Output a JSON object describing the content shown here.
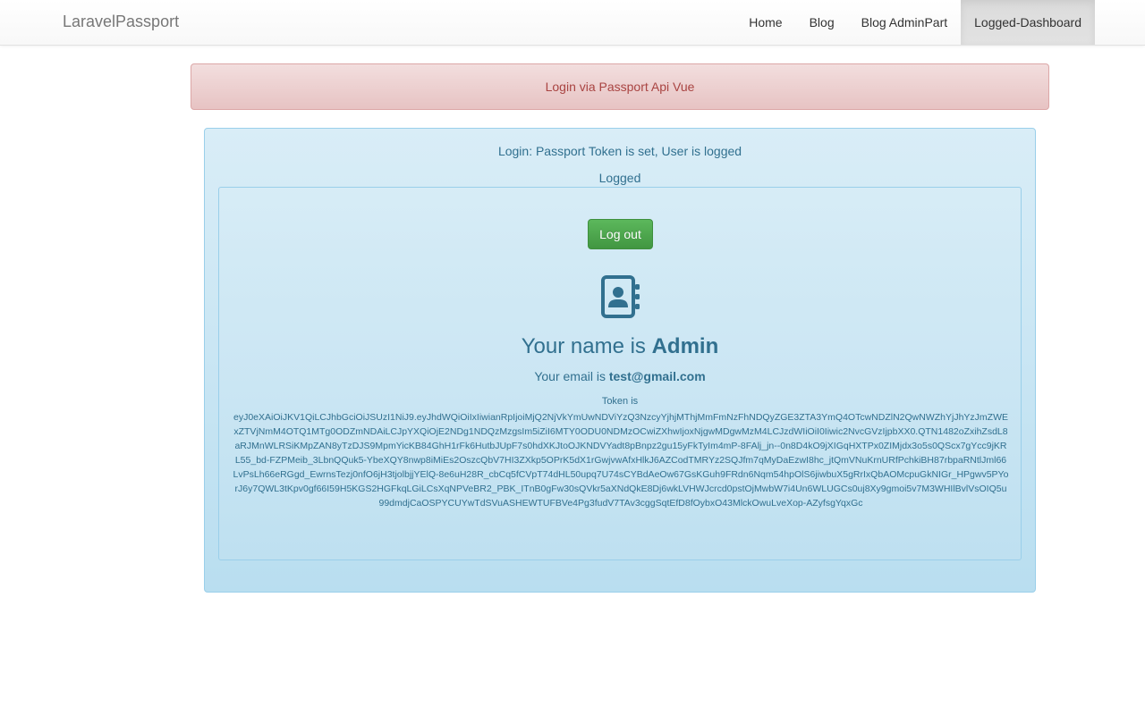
{
  "navbar": {
    "brand": "LaravelPassport",
    "items": [
      {
        "label": "Home"
      },
      {
        "label": "Blog"
      },
      {
        "label": "Blog AdminPart"
      },
      {
        "label": "Logged-Dashboard",
        "active": true
      }
    ]
  },
  "alert": {
    "text": "Login via Passport Api Vue"
  },
  "panel": {
    "status": "Login: Passport Token is set, User is logged",
    "state": "Logged",
    "logout_label": "Log out",
    "icon": "address-book-icon",
    "name_prefix": "Your name is ",
    "name": "Admin",
    "email_prefix": "Your email is ",
    "email": "test@gmail.com",
    "token_label": "Token is",
    "token": "eyJ0eXAiOiJKV1QiLCJhbGciOiJSUzI1NiJ9.eyJhdWQiOiIxIiwianRpIjoiMjQ2NjVkYmUwNDViYzQ3NzcyYjhjMThjMmFmNzFhNDQyZGE3ZTA3YmQ4OTcwNDZlN2QwNWZhYjJhYzJmZWExZTVjNmM4OTQ1MTg0ODZmNDAiLCJpYXQiOjE2NDg1NDQzMzgsIm5iZiI6MTY0ODU0NDMzOCwiZXhwIjoxNjgwMDgwMzM4LCJzdWIiOiI0Iiwic2NvcGVzIjpbXX0.QTN1482oZxihZsdL8aRJMnWLRSiKMpZAN8yTzDJS9MpmYicKB84GhH1rFk6HutbJUpF7s0hdXKJtoOJKNDVYadt8pBnpz2gu15yFkTyIm4mP-8FAlj_jn--0n8D4kO9jXIGqHXTPx0ZIMjdx3o5s0QScx7gYcc9jKRL55_bd-FZPMeib_3LbnQQuk5-YbeXQY8nwp8iMiEs2OszcQbV7HI3ZXkp5OPrK5dX1rGwjvwAfxHlkJ6AZCodTMRYz2SQJfm7qMyDaEzwI8hc_jtQmVNuKrnURfPchkiBH87rbpaRNtlJml66LvPsLh66eRGgd_EwrnsTezj0nfO6jH3tjolbjjYElQ-8e6uH28R_cbCq5fCVpT74dHL50upq7U74sCYBdAeOw67GsKGuh9FRdn6Nqm54hpOlS6jiwbuX5gRrIxQbAOMcpuGkNIGr_HPgwv5PYorJ6y7QWL3tKpv0gf66I59H5KGS2HGFkqLGiLCsXqNPVeBR2_PBK_ITnB0gFw30sQVkr5aXNdQkE8Dj6wkLVHWJcrcd0pstOjMwbW7i4Un6WLUGCs0uj8Xy9gmoi5v7M3WHIlBvlVsOIQ5u99dmdjCaOSPYCUYwTdSVuASHEWTUFBVe4Pg3fudV7TAv3cggSqtEfD8fOybxO43MlckOwuLveXop-AZyfsgYqxGc"
  },
  "colors": {
    "info_text": "#31708f",
    "danger_text": "#a94442",
    "success_button": "#5cb85c"
  }
}
